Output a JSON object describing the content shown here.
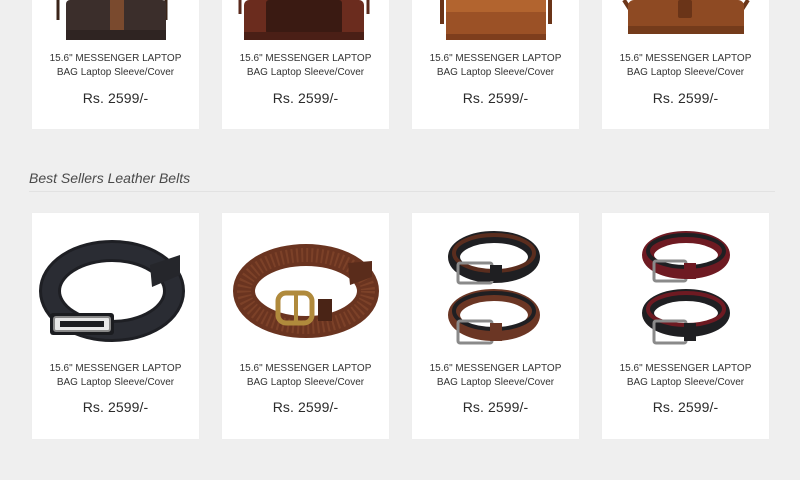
{
  "bags_section": {
    "products": [
      {
        "image": "brown-messenger-bag-image",
        "title_line1": "15.6\" MESSENGER LAPTOP",
        "title_line2": "BAG Laptop Sleeve/Cover",
        "price": "Rs. 2599/-"
      },
      {
        "image": "dark-brown-messenger-bag-image",
        "title_line1": "15.6\" MESSENGER LAPTOP",
        "title_line2": "BAG Laptop Sleeve/Cover",
        "price": "Rs. 2599/-"
      },
      {
        "image": "tan-messenger-bag-image",
        "title_line1": "15.6\" MESSENGER LAPTOP",
        "title_line2": "BAG Laptop Sleeve/Cover",
        "price": "Rs. 2599/-"
      },
      {
        "image": "tan-satchel-bag-image",
        "title_line1": "15.6\" MESSENGER LAPTOP",
        "title_line2": "BAG Laptop Sleeve/Cover",
        "price": "Rs. 2599/-"
      }
    ]
  },
  "belts_section": {
    "title": "Best Sellers Leather Belts",
    "products": [
      {
        "image": "black-belt-image",
        "title_line1": "15.6\" MESSENGER LAPTOP",
        "title_line2": "BAG Laptop Sleeve/Cover",
        "price": "Rs. 2599/-"
      },
      {
        "image": "brown-textured-belt-image",
        "title_line1": "15.6\" MESSENGER LAPTOP",
        "title_line2": "BAG Laptop Sleeve/Cover",
        "price": "Rs. 2599/-"
      },
      {
        "image": "black-brown-belt-pair-image",
        "title_line1": "15.6\" MESSENGER LAPTOP",
        "title_line2": "BAG Laptop Sleeve/Cover",
        "price": "Rs. 2599/-"
      },
      {
        "image": "maroon-black-belt-pair-image",
        "title_line1": "15.6\" MESSENGER LAPTOP",
        "title_line2": "BAG Laptop Sleeve/Cover",
        "price": "Rs. 2599/-"
      }
    ]
  },
  "colors": {
    "page_background": "#efefef",
    "card_background": "#ffffff",
    "text": "#333333"
  }
}
